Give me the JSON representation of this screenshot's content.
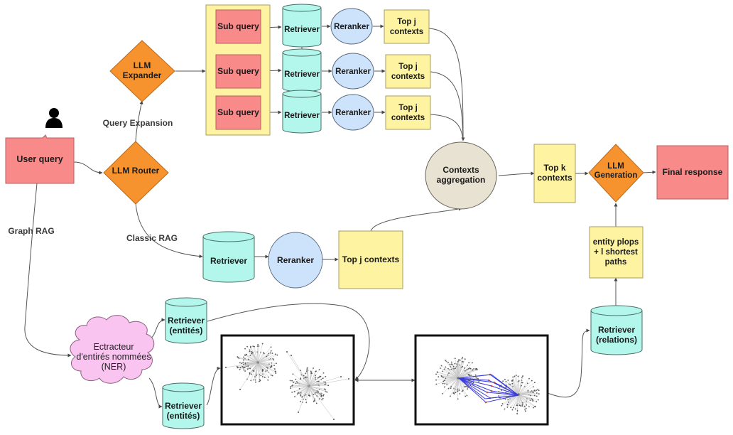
{
  "user": {
    "icon": "person-icon",
    "query_label": "User query"
  },
  "router": {
    "label": "LLM Router"
  },
  "expander": {
    "label_line1": "LLM",
    "label_line2": "Expander"
  },
  "edges": {
    "query_expansion": "Query Expansion",
    "classic_rag": "Classic RAG",
    "graph_rag": "Graph RAG"
  },
  "expansion_branches": [
    {
      "sub_query": "Sub query",
      "retriever": "Retriever",
      "reranker": "Reranker",
      "top_line1": "Top j",
      "top_line2": "contexts"
    },
    {
      "sub_query": "Sub query",
      "retriever": "Retriever",
      "reranker": "Reranker",
      "top_line1": "Top j",
      "top_line2": "contexts"
    },
    {
      "sub_query": "Sub query",
      "retriever": "Retriever",
      "reranker": "Reranker",
      "top_line1": "Top j",
      "top_line2": "contexts"
    }
  ],
  "classic": {
    "retriever": "Retriever",
    "reranker": "Reranker",
    "top": "Top j contexts"
  },
  "aggregation": {
    "line1": "Contexts",
    "line2": "aggregation"
  },
  "topk": {
    "line1": "Top k",
    "line2": "contexts"
  },
  "generation": {
    "line1": "LLM",
    "line2": "Generation"
  },
  "final": {
    "label": "Final response"
  },
  "graph": {
    "ner_line1": "Ectracteur",
    "ner_line2": "d'entirés nommées",
    "ner_line3": "(NER)",
    "retriever_entities_top_line1": "Retriever",
    "retriever_entities_top_line2": "(entités)",
    "retriever_entities_bottom_line1": "Retriever",
    "retriever_entities_bottom_line2": "(entités)",
    "retriever_relations_line1": "Retriever",
    "retriever_relations_line2": "(relations)",
    "paths_line1": "entity plops",
    "paths_line2": "+ l shortest",
    "paths_line3": "paths",
    "graph_before": "knowledge-graph-image",
    "graph_after": "knowledge-graph-paths-image"
  },
  "colors": {
    "pink": "#f88a8a",
    "orange": "#f7932e",
    "yellow": "#fdf3a1",
    "cyan": "#b3f6ec",
    "blue": "#cde2fb",
    "beige": "#e8e2d2",
    "cloud": "#f9c4ef",
    "highlight": "#3b3bdc"
  }
}
